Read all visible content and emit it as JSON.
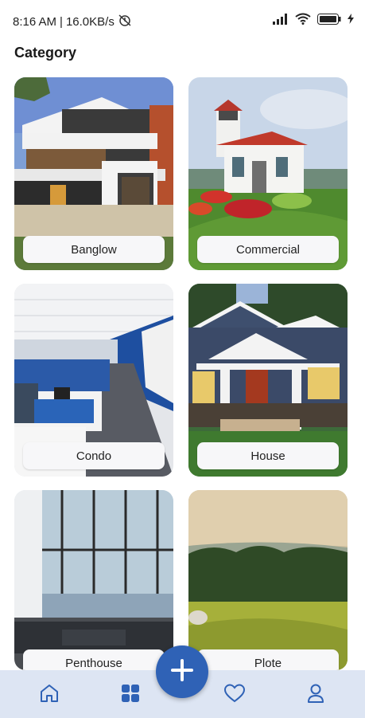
{
  "status_bar": {
    "time": "8:16 AM",
    "separator": "|",
    "network_speed": "16.0KB/s",
    "icons": [
      "alarm-off-icon",
      "signal-icon",
      "wifi-icon",
      "battery-icon",
      "charging-icon"
    ]
  },
  "page": {
    "title": "Category"
  },
  "categories": [
    {
      "label": "Banglow",
      "image": "modern-house-photo"
    },
    {
      "label": "Commercial",
      "image": "lighthouse-building-photo"
    },
    {
      "label": "Condo",
      "image": "office-interior-photo"
    },
    {
      "label": "House",
      "image": "craftsman-house-photo"
    },
    {
      "label": "Penthouse",
      "image": "penthouse-interior-photo"
    },
    {
      "label": "Plote",
      "image": "field-land-photo"
    }
  ],
  "bottom_nav": {
    "items": [
      "home-icon",
      "grid-icon",
      "heart-icon",
      "profile-icon"
    ],
    "fab_icon": "plus-icon"
  },
  "colors": {
    "accent": "#2f62b6",
    "nav_background": "#dde5f3",
    "label_background": "#f7f7f9"
  }
}
